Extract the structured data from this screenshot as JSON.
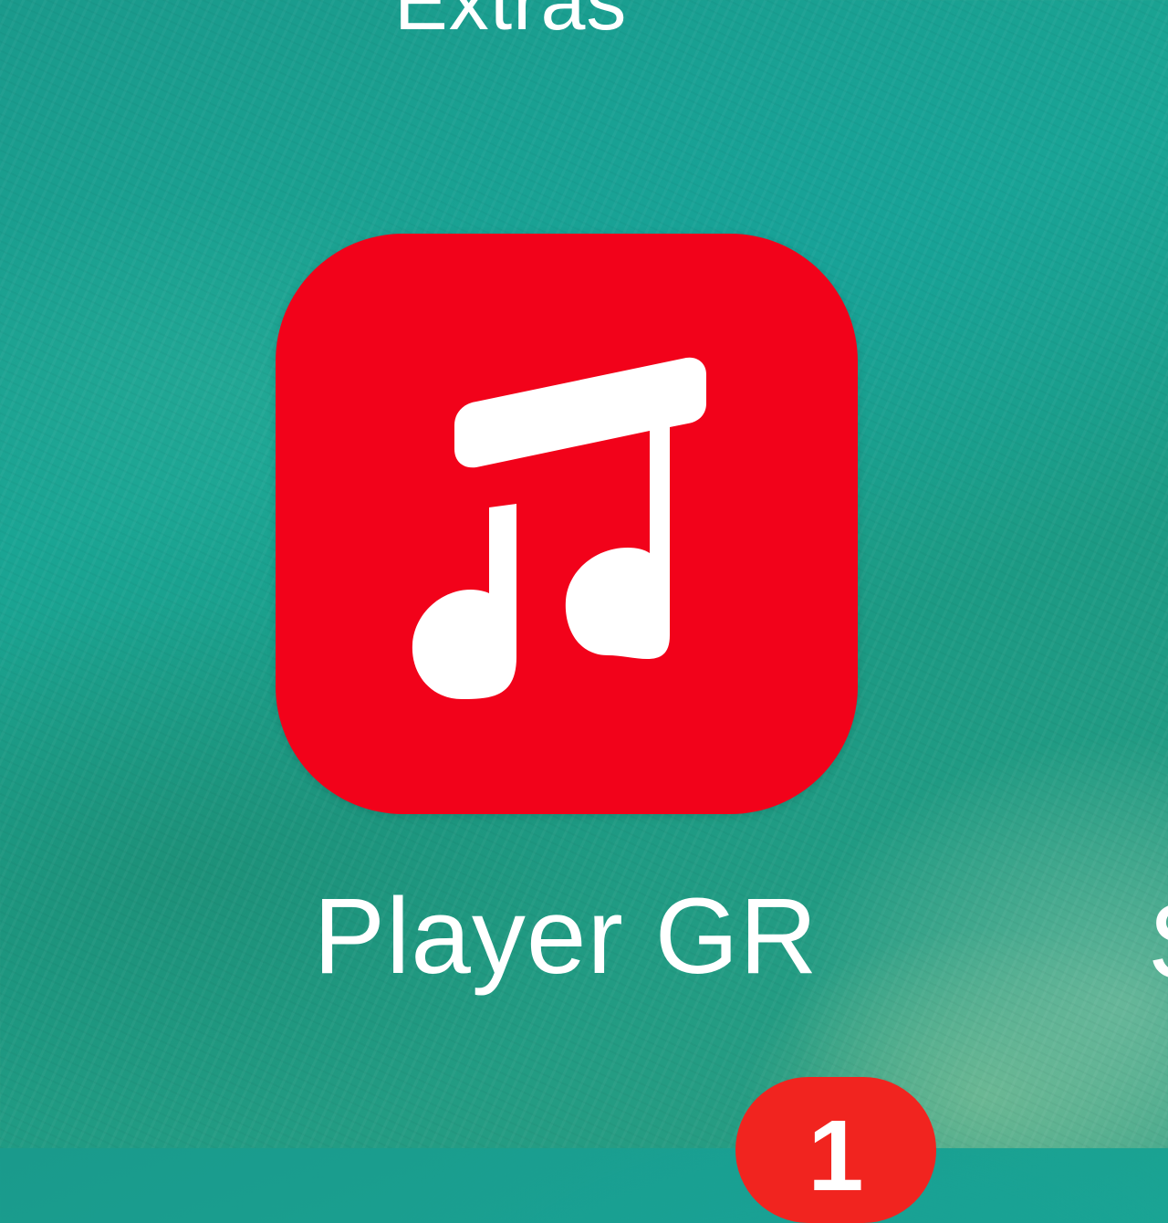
{
  "home_screen": {
    "top_label": "Extras",
    "app": {
      "name": "Player GR",
      "icon": "music-note-icon",
      "icon_color": "#f2021a"
    },
    "edge_label": "S",
    "badge_count": "1",
    "badge_color": "#f1241f"
  }
}
